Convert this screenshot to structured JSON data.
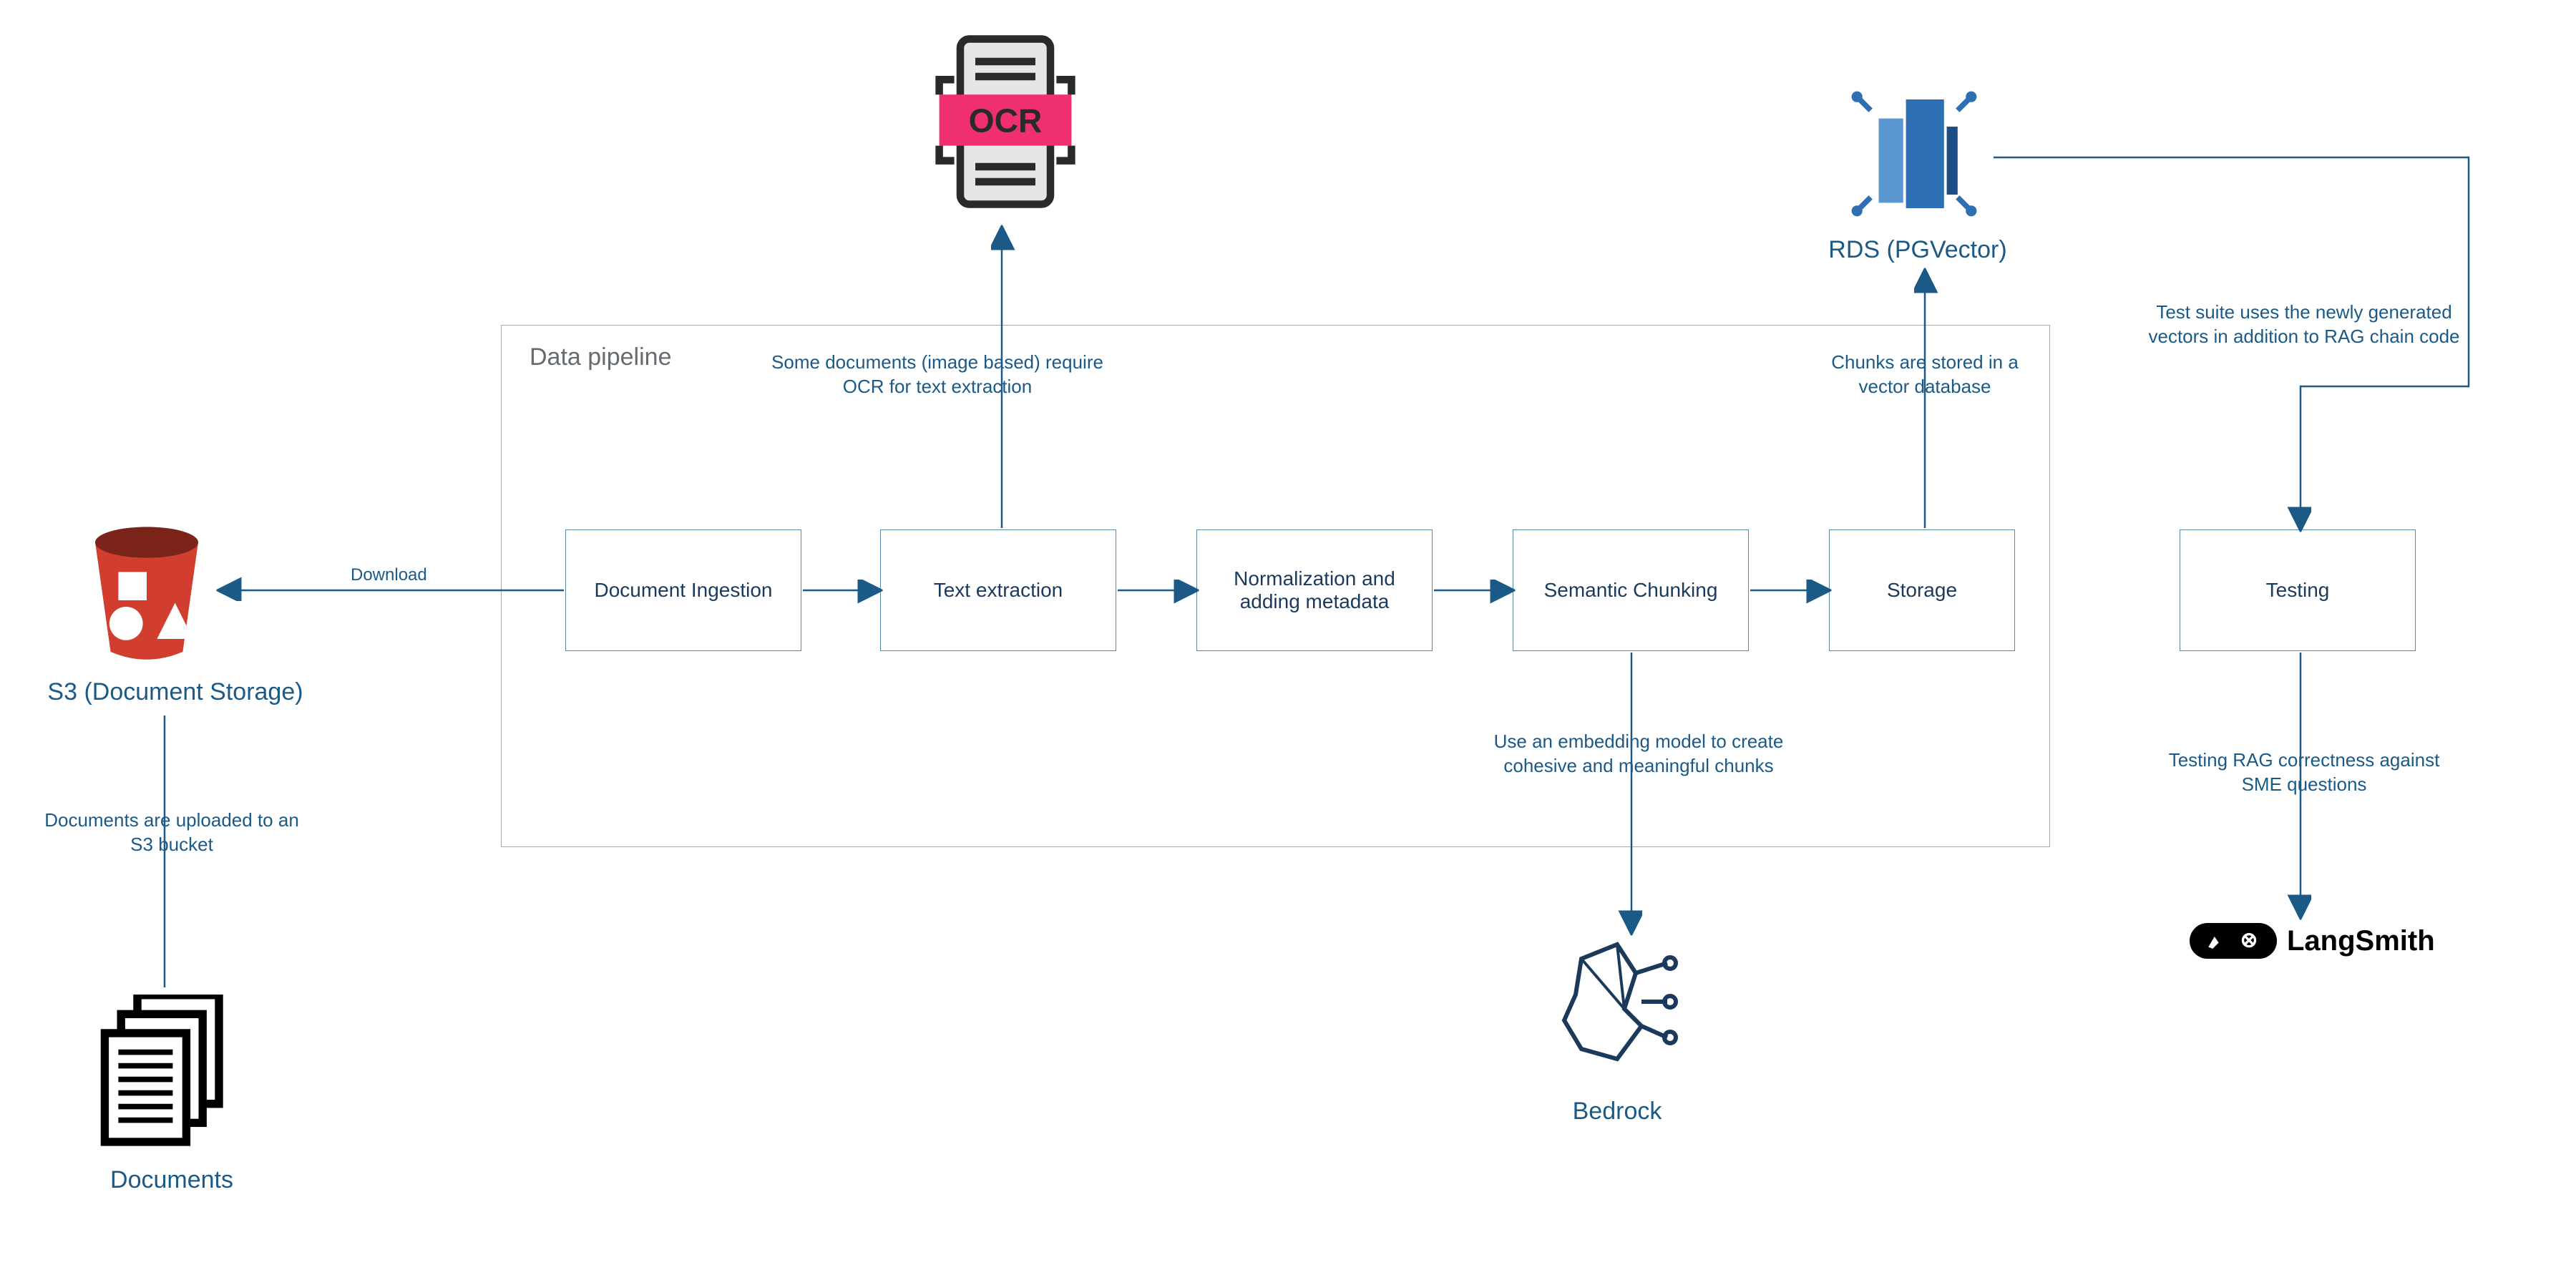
{
  "pipeline": {
    "title": "Data pipeline",
    "steps": {
      "ingestion": "Document Ingestion",
      "extraction": "Text extraction",
      "normalization": "Normalization and adding metadata",
      "chunking": "Semantic Chunking",
      "storage": "Storage",
      "testing": "Testing"
    }
  },
  "labels": {
    "s3": "S3 (Document Storage)",
    "documents": "Documents",
    "rds": "RDS (PGVector)",
    "bedrock": "Bedrock",
    "langsmith": "LangSmith",
    "download": "Download"
  },
  "captions": {
    "s3_upload": "Documents are uploaded to an S3 bucket",
    "ocr_note": "Some documents (image based) require OCR for text extraction",
    "chunks_stored": "Chunks are stored in a vector database",
    "embedding_note": "Use an embedding model to create cohesive and meaningful chunks",
    "test_suite": "Test suite uses the newly generated vectors in addition to RAG chain code",
    "test_correctness": "Testing RAG correctness against SME questions"
  },
  "icons": {
    "ocr_badge": "OCR"
  }
}
